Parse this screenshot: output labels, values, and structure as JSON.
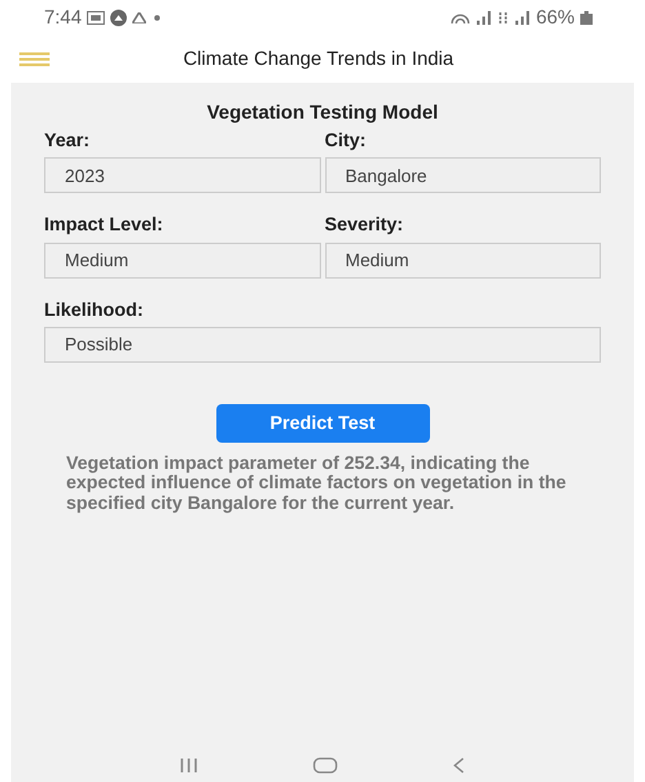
{
  "status_bar": {
    "time": "7:44",
    "battery": "66%"
  },
  "app_bar": {
    "title": "Climate Change Trends in India"
  },
  "form": {
    "title": "Vegetation Testing Model",
    "fields": [
      {
        "label": "Year:",
        "value": "2023"
      },
      {
        "label": "City:",
        "value": "Bangalore"
      },
      {
        "label": "Impact Level:",
        "value": "Medium"
      },
      {
        "label": "Severity:",
        "value": "Medium"
      },
      {
        "label": "Likelihood:",
        "value": "Possible"
      }
    ],
    "button": "Predict Test",
    "result": "Vegetation impact parameter of 252.34, indicating the expected influence of climate factors on vegetation in the specified city Bangalore for the current year."
  }
}
